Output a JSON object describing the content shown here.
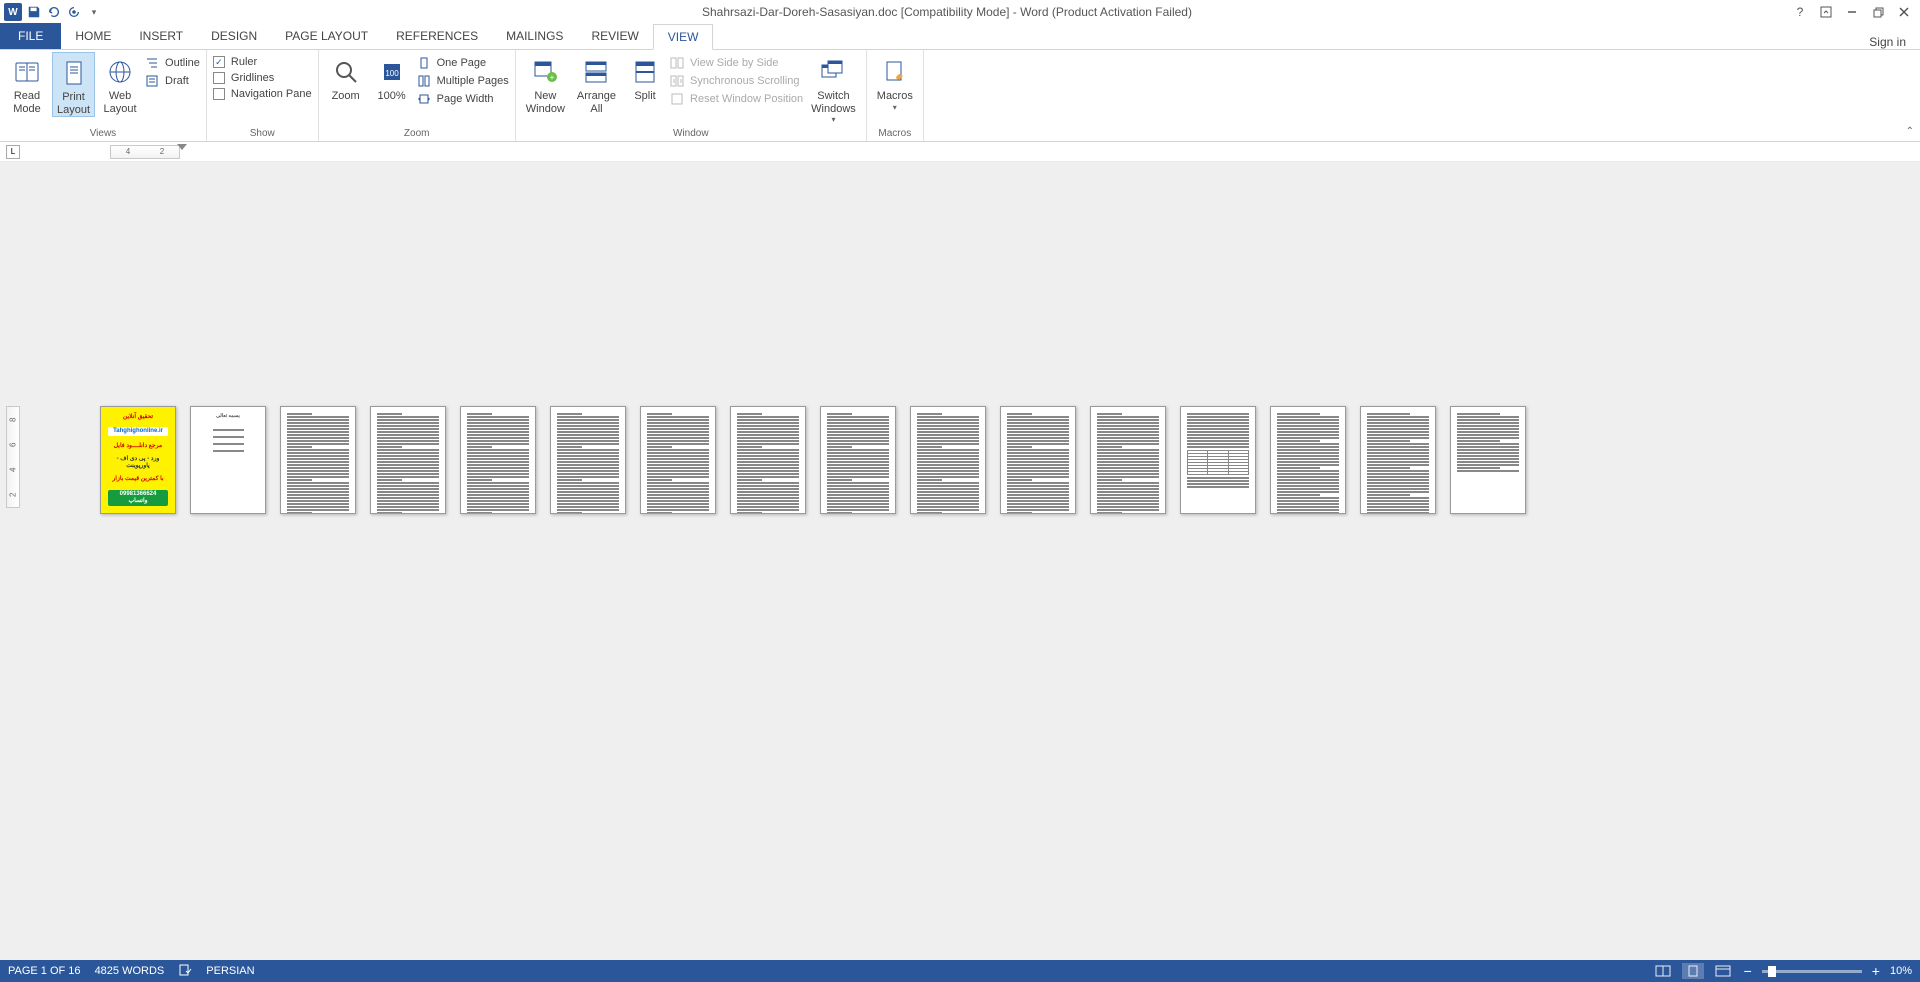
{
  "title": "Shahrsazi-Dar-Doreh-Sasasiyan.doc [Compatibility Mode] - Word (Product Activation Failed)",
  "signin": "Sign in",
  "tabs": {
    "file": "FILE",
    "home": "HOME",
    "insert": "INSERT",
    "design": "DESIGN",
    "page_layout": "PAGE LAYOUT",
    "references": "REFERENCES",
    "mailings": "MAILINGS",
    "review": "REVIEW",
    "view": "VIEW"
  },
  "ribbon": {
    "views": {
      "read_mode": "Read\nMode",
      "print_layout": "Print\nLayout",
      "web_layout": "Web\nLayout",
      "outline": "Outline",
      "draft": "Draft",
      "label": "Views"
    },
    "show": {
      "ruler": "Ruler",
      "gridlines": "Gridlines",
      "nav_pane": "Navigation Pane",
      "label": "Show",
      "ruler_checked": true,
      "gridlines_checked": false,
      "nav_checked": false
    },
    "zoom": {
      "zoom": "Zoom",
      "one_hundred": "100%",
      "one_page": "One Page",
      "multiple_pages": "Multiple Pages",
      "page_width": "Page Width",
      "label": "Zoom"
    },
    "window": {
      "new_window": "New\nWindow",
      "arrange_all": "Arrange\nAll",
      "split": "Split",
      "side_by_side": "View Side by Side",
      "sync_scroll": "Synchronous Scrolling",
      "reset_pos": "Reset Window Position",
      "switch_windows": "Switch\nWindows",
      "label": "Window"
    },
    "macros": {
      "macros": "Macros",
      "label": "Macros"
    }
  },
  "ruler": {
    "h1": "4",
    "h2": "2",
    "v1": "2",
    "v2": "4",
    "v3": "6",
    "v4": "8"
  },
  "status": {
    "page": "PAGE 1 OF 16",
    "words": "4825 WORDS",
    "lang": "PERSIAN",
    "zoom": "10%"
  },
  "cover": {
    "l1": "تحقیق آنلاین",
    "l2": "Tahghighonline.ir",
    "l3": "مرجع دانلــــود فایل",
    "l4": "ورد - پی دی اف - پاورپوینت",
    "l5": "با کمترین قیمت بازار",
    "l6": "09981366624 واتساپ"
  },
  "page2": {
    "title": "بسمه تعالی"
  },
  "pages_count": 16
}
